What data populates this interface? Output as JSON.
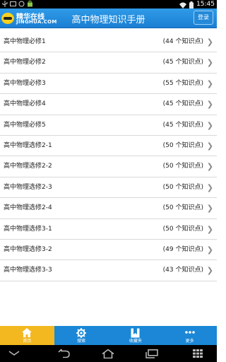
{
  "status_bar": {
    "time": "15:45"
  },
  "header": {
    "logo_name": "精华在线",
    "logo_sub": "JINGHUA.COM",
    "title": "高中物理知识手册",
    "login_label": "登录"
  },
  "list": [
    {
      "label": "高中物理必修1",
      "count": "(44 个知识点)"
    },
    {
      "label": "高中物理必修2",
      "count": "(45 个知识点)"
    },
    {
      "label": "高中物理必修3",
      "count": "(55 个知识点)"
    },
    {
      "label": "高中物理必修4",
      "count": "(45 个知识点)"
    },
    {
      "label": "高中物理必修5",
      "count": "(45 个知识点)"
    },
    {
      "label": "高中物理选修2-1",
      "count": "(50 个知识点)"
    },
    {
      "label": "高中物理选修2-2",
      "count": "(50 个知识点)"
    },
    {
      "label": "高中物理选修2-3",
      "count": "(50 个知识点)"
    },
    {
      "label": "高中物理选修2-4",
      "count": "(50 个知识点)"
    },
    {
      "label": "高中物理选修3-1",
      "count": "(50 个知识点)"
    },
    {
      "label": "高中物理选修3-2",
      "count": "(49 个知识点)"
    },
    {
      "label": "高中物理选修3-3",
      "count": "(43 个知识点)"
    }
  ],
  "tabs": [
    {
      "label": "首页",
      "icon": "home-icon",
      "active": true
    },
    {
      "label": "搜索",
      "icon": "gear-icon",
      "active": false
    },
    {
      "label": "收藏夹",
      "icon": "bookmark-icon",
      "active": false
    },
    {
      "label": "更多",
      "icon": "more-icon",
      "active": false
    }
  ],
  "colors": {
    "header_blue": "#1b7fd3",
    "tab_bar_blue": "#1b87d6",
    "active_tab_yellow": "#f3b820"
  }
}
